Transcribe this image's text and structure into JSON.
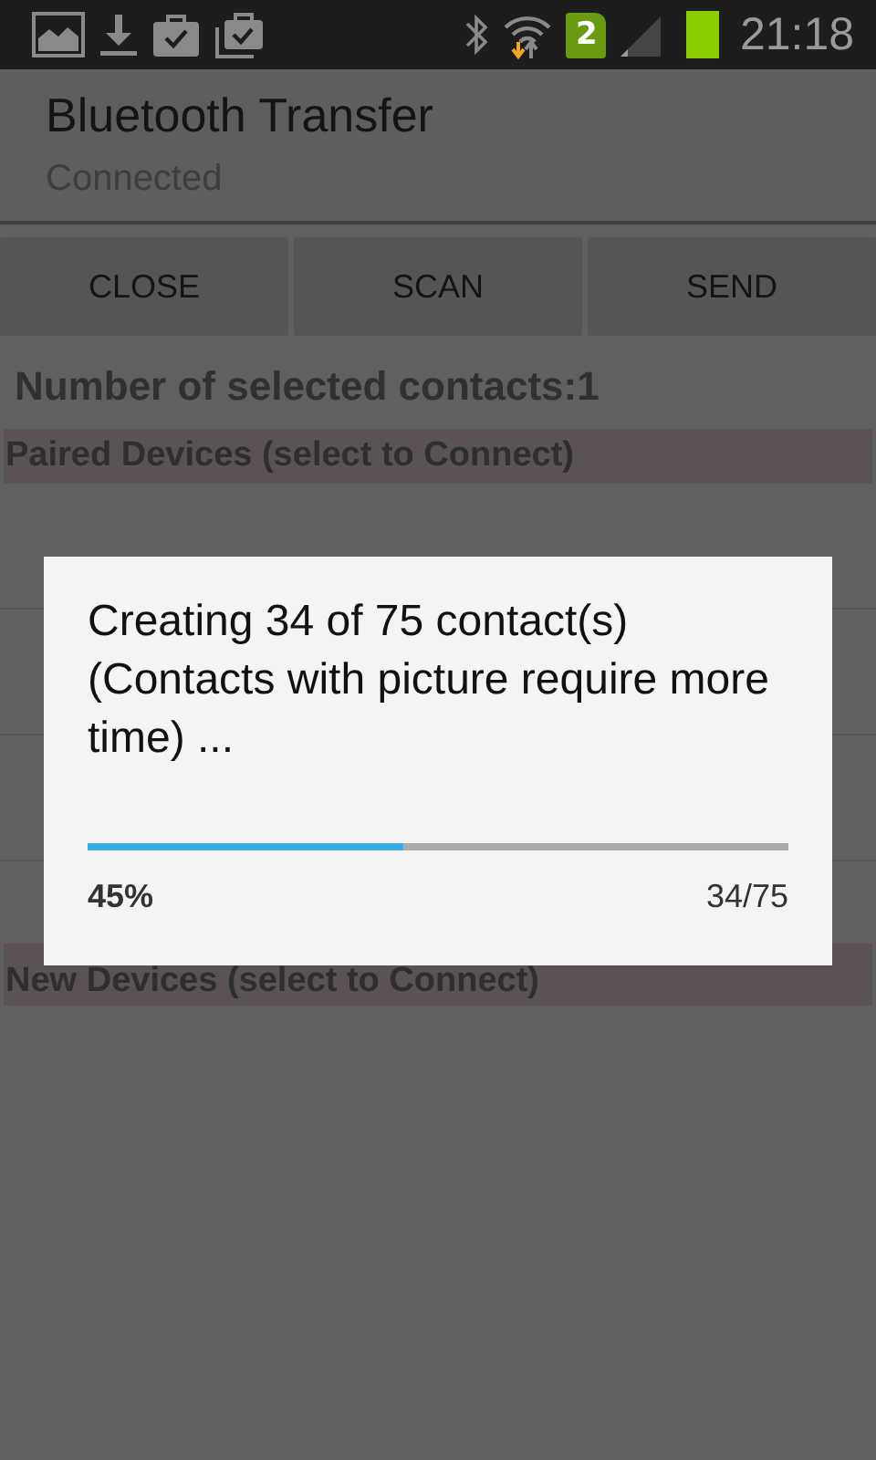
{
  "status_bar": {
    "sim_badge": "2",
    "time": "21:18"
  },
  "action_bar": {
    "title": "Bluetooth Transfer",
    "subtitle": "Connected"
  },
  "buttons": [
    "CLOSE",
    "SCAN",
    "SEND"
  ],
  "selected_count": "Number of selected contacts:1",
  "paired_header": "Paired Devices (select to Connect)",
  "new_header": "New Devices (select to Connect)",
  "dialog": {
    "message": "Creating 34 of 75 contact(s) (Contacts with picture require more time) ...",
    "level": 0.45,
    "percent": "45%",
    "count": "34/75"
  }
}
